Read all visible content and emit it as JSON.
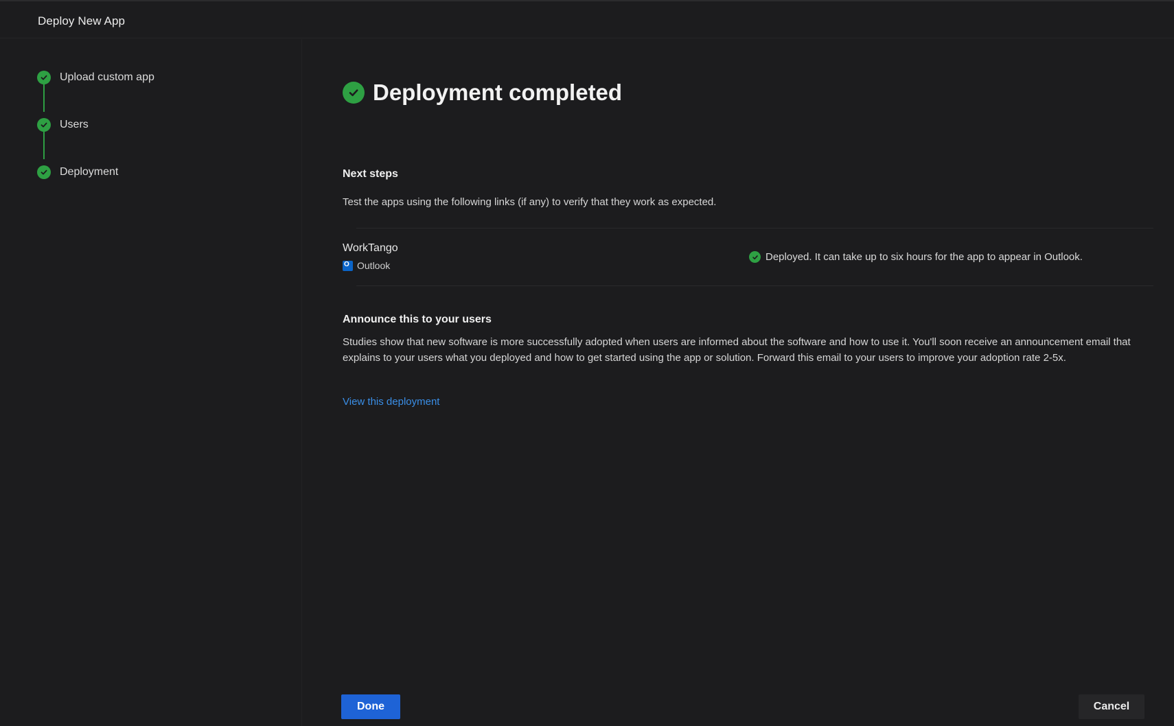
{
  "header": {
    "title": "Deploy New App"
  },
  "steps": [
    {
      "label": "Upload custom app",
      "status": "complete"
    },
    {
      "label": "Users",
      "status": "complete"
    },
    {
      "label": "Deployment",
      "status": "complete"
    }
  ],
  "main": {
    "title": "Deployment completed",
    "next_steps": {
      "heading": "Next steps",
      "description": "Test the apps using the following links (if any) to verify that they work as expected."
    },
    "app": {
      "name": "WorkTango",
      "host": "Outlook",
      "status_text": "Deployed. It can take up to six hours for the app to appear in Outlook."
    },
    "announce": {
      "heading": "Announce this to your users",
      "body": "Studies show that new software is more successfully adopted when users are informed about the software and how to use it. You'll soon receive an announcement email that explains to your users what you deployed and how to get started using the app or solution. Forward this email to your users to improve your adoption rate 2-5x.",
      "link": "View this deployment"
    }
  },
  "footer": {
    "done_label": "Done",
    "cancel_label": "Cancel"
  },
  "colors": {
    "success": "#2ea043",
    "primary": "#1e63d6",
    "link": "#3a8ee6",
    "background": "#1c1c1e"
  },
  "icons": {
    "step": "check-circle-icon",
    "host": "outlook-icon"
  }
}
